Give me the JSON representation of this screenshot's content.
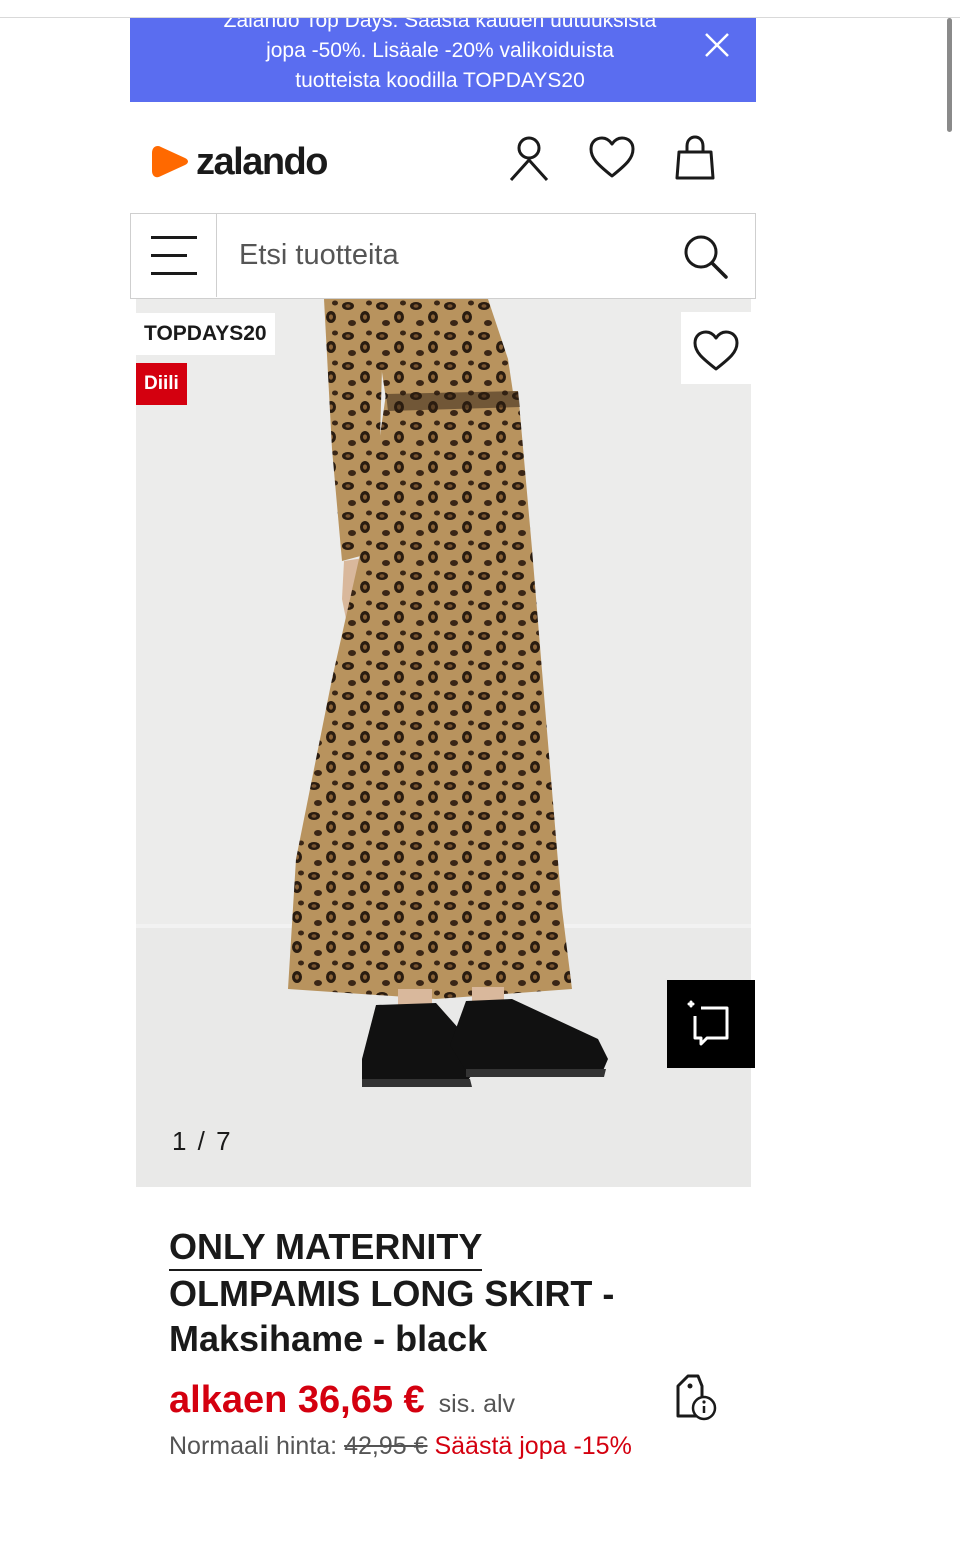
{
  "banner": {
    "partial_line": "Zalando Top Days: Säästä kauden uutuuksista",
    "line1": "jopa -50%. Lisäale -20% valikoiduista",
    "line2": "tuotteista koodilla TOPDAYS20",
    "close_icon": "close-icon"
  },
  "header": {
    "logo_text": "zalando",
    "icons": [
      "account-icon",
      "heart-icon",
      "bag-icon"
    ]
  },
  "search": {
    "placeholder": "Etsi tuotteita",
    "menu_icon": "hamburger-menu-icon",
    "search_icon": "search-icon"
  },
  "gallery": {
    "badge_code": "TOPDAYS20",
    "badge_deal": "Diili",
    "counter": "1 / 7",
    "wishlist_icon": "heart-icon",
    "similar_icon": "find-similar-icon"
  },
  "product": {
    "brand": "ONLY MATERNITY",
    "name": "OLMPAMIS LONG SKIRT - Maksihame - black",
    "price": "alkaen 36,65 €",
    "vat": "sis. alv",
    "normal_label": "Normaali hinta:",
    "normal_price": "42,95 €",
    "saving": "Säästä jopa -15%",
    "price_info_icon": "price-info-icon"
  },
  "colors": {
    "accent_red": "#d4000f",
    "banner_blue": "#5a6df0",
    "brand_orange": "#ff6900"
  }
}
